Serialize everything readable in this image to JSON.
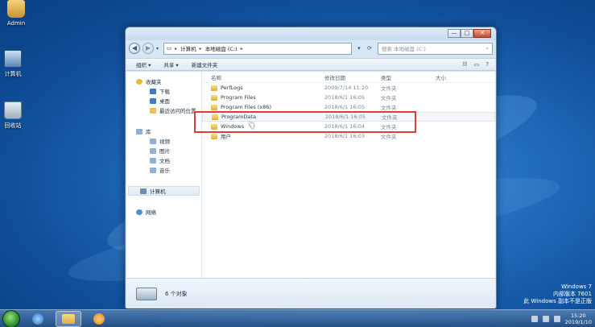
{
  "desktop": {
    "icons": [
      {
        "label": "Admin"
      },
      {
        "label": "计算机"
      },
      {
        "label": "回收站"
      }
    ],
    "watermark": [
      "Windows 7",
      "内部版本 7601",
      "此 Windows 副本不是正版"
    ]
  },
  "explorer": {
    "caption": {
      "minimize": "—",
      "maximize": "□",
      "close": "✕"
    },
    "address": {
      "root": "计算机",
      "drive": "本地磁盘 (C:)"
    },
    "search": {
      "placeholder": "搜索 本地磁盘 (C:)"
    },
    "commands": {
      "organize": "组织 ▾",
      "share": "共享 ▾",
      "new_folder": "新建文件夹"
    },
    "nav": {
      "favorites": "收藏夹",
      "downloads": "下载",
      "desktop": "桌面",
      "recent": "最近访问的位置",
      "libraries": "库",
      "videos": "视频",
      "pictures": "图片",
      "documents": "文档",
      "music": "音乐",
      "computer": "计算机",
      "network": "网络"
    },
    "columns": {
      "name": "名称",
      "date": "修改日期",
      "type": "类型",
      "size": "大小"
    },
    "files": [
      {
        "name": "PerfLogs",
        "date": "2009/7/14 11:20",
        "type": "文件夹"
      },
      {
        "name": "Program Files",
        "date": "2018/6/1 16:05",
        "type": "文件夹"
      },
      {
        "name": "Program Files (x86)",
        "date": "2018/6/1 16:05",
        "type": "文件夹"
      },
      {
        "name": "ProgramData",
        "date": "2018/6/1 16:05",
        "type": "文件夹"
      },
      {
        "name": "Windows",
        "date": "2018/6/1 16:04",
        "type": "文件夹"
      },
      {
        "name": "用户",
        "date": "2018/6/1 16:03",
        "type": "文件夹"
      }
    ],
    "status": {
      "count": "6 个对象"
    }
  },
  "taskbar": {
    "clock": {
      "time": "15:20",
      "date": "2019/1/10"
    }
  }
}
